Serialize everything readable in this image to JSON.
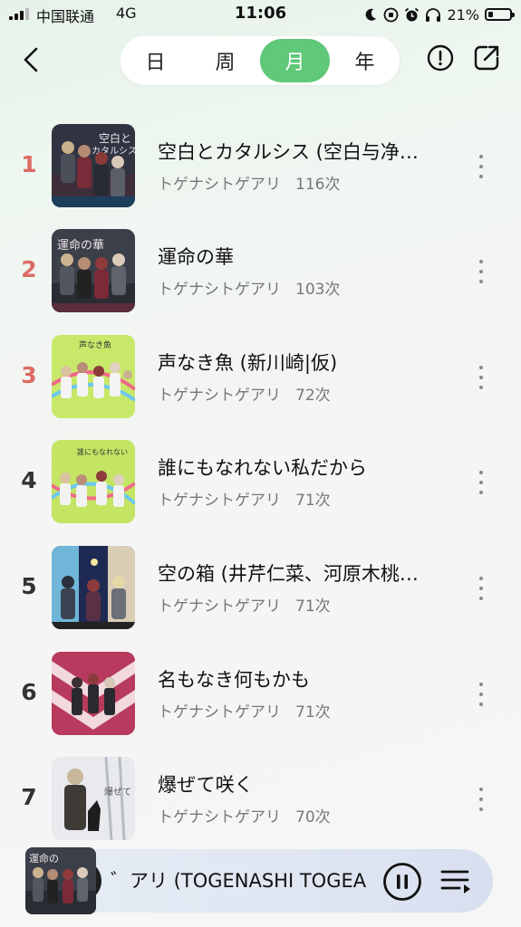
{
  "status_bar": {
    "carrier": "中国联通",
    "network": "4G",
    "time": "11:06",
    "battery": "21%",
    "battery_fraction": 0.21
  },
  "tabs": [
    {
      "label": "日",
      "active": false
    },
    {
      "label": "周",
      "active": false
    },
    {
      "label": "月",
      "active": true
    },
    {
      "label": "年",
      "active": false
    }
  ],
  "colors": {
    "accent": "#5fc879",
    "rank_top": "#dc6b63"
  },
  "icons": {
    "back": "chevron-left-icon",
    "info": "exclamation-circle-icon",
    "share": "share-icon",
    "more": "vertical-dots-icon",
    "pause": "pause-icon",
    "queue": "playlist-icon"
  },
  "songs": [
    {
      "rank": "1",
      "title": "空白とカタルシス (空白与净…",
      "artist": "トゲナシトゲアリ",
      "plays": "116次"
    },
    {
      "rank": "2",
      "title": "運命の華",
      "artist": "トゲナシトゲアリ",
      "plays": "103次"
    },
    {
      "rank": "3",
      "title": "声なき魚 (新川崎|仮)",
      "artist": "トゲナシトゲアリ",
      "plays": "72次"
    },
    {
      "rank": "4",
      "title": "誰にもなれない私だから",
      "artist": "トゲナシトゲアリ",
      "plays": "71次"
    },
    {
      "rank": "5",
      "title": "空の箱 (井芹仁菜、河原木桃…",
      "artist": "トゲナシトゲアリ",
      "plays": "71次"
    },
    {
      "rank": "6",
      "title": "名もなき何もかも",
      "artist": "トゲナシトゲアリ",
      "plays": "71次"
    },
    {
      "rank": "7",
      "title": "爆ぜて咲く",
      "artist": "トゲナシトゲアリ",
      "plays": "70次"
    }
  ],
  "player": {
    "now_playing": "゛アリ (TOGENASHI TOGEARI)"
  }
}
